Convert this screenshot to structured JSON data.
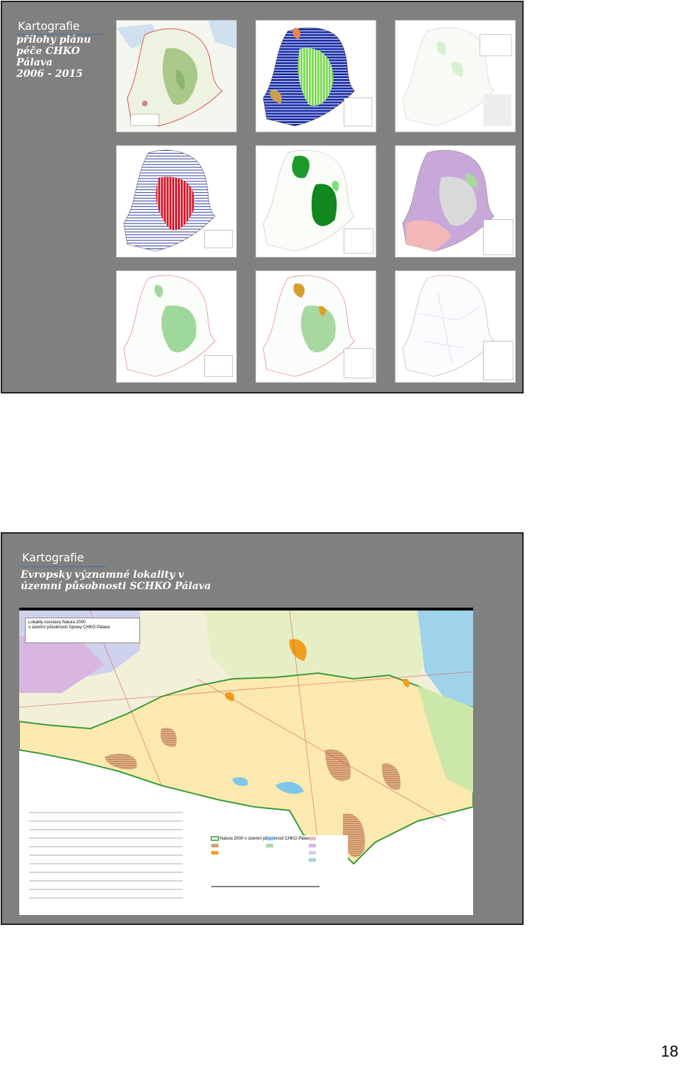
{
  "slide1": {
    "kicker": "Kartografie",
    "title_lines": [
      "přílohy plánu",
      "péče CHKO",
      "Pálava",
      "2006 - 2015"
    ]
  },
  "slide2": {
    "kicker": "Kartografie",
    "title_lines": [
      "Evropsky významné lokality v",
      "územní působnosti SCHKO Pálava"
    ],
    "map_title_lines": [
      "Lokality soustavy Natura 2000",
      "v územní působnosti Správy CHKO Pálava"
    ],
    "legend_title": "Natura 2000 v  územní působnosti CHKO Pálava"
  },
  "page_number": "18"
}
